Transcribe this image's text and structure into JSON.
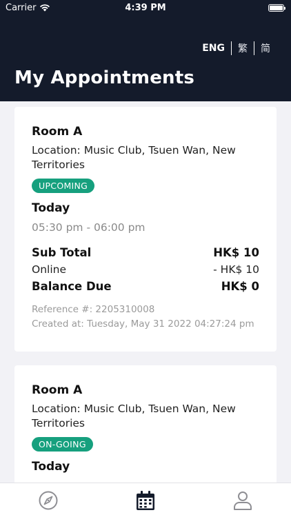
{
  "status_bar": {
    "carrier": "Carrier",
    "time": "4:39 PM"
  },
  "languages": [
    {
      "label": "ENG",
      "active": true
    },
    {
      "label": "繁",
      "active": false
    },
    {
      "label": "简",
      "active": false
    }
  ],
  "page_title": "My Appointments",
  "appointments": [
    {
      "room": "Room A",
      "location": "Location: Music Club, Tsuen Wan, New Territories",
      "status": "UPCOMING",
      "date": "Today",
      "time": "05:30 pm - 06:00 pm",
      "sub_total_label": "Sub Total",
      "sub_total_value": "HK$ 10",
      "online_label": "Online",
      "online_value": "- HK$ 10",
      "balance_label": "Balance Due",
      "balance_value": "HK$ 0",
      "reference": "Reference #: 2205310008",
      "created_at": "Created at: Tuesday, May 31 2022 04:27:24 pm"
    },
    {
      "room": "Room A",
      "location": "Location: Music Club, Tsuen Wan, New Territories",
      "status": "ON-GOING",
      "date": "Today"
    }
  ],
  "tabs": [
    {
      "icon": "compass-icon",
      "active": false
    },
    {
      "icon": "calendar-icon",
      "active": true
    },
    {
      "icon": "profile-icon",
      "active": false
    }
  ],
  "colors": {
    "header_bg": "#141b2b",
    "badge_green": "#16a07e",
    "page_bg": "#f2f2f6"
  }
}
